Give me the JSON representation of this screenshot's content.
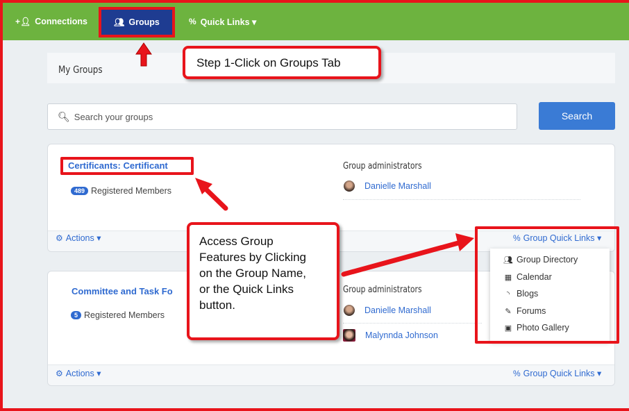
{
  "nav": {
    "connections_label": "Connections",
    "groups_label": "Groups",
    "quicklinks_label": "Quick Links ▾"
  },
  "header": {
    "title": "My Groups"
  },
  "search": {
    "placeholder": "Search your groups",
    "button_label": "Search"
  },
  "groups": [
    {
      "name": "Certificants: Certificant",
      "member_count": "489",
      "members_label": "Registered Members",
      "admins_title": "Group administrators",
      "admins": [
        "Danielle Marshall"
      ],
      "actions_label": "Actions ▾",
      "quicklinks_label": "Group Quick Links ▾"
    },
    {
      "name": "Committee and Task Fo",
      "member_count": "5",
      "members_label": "Registered Members",
      "admins_title": "Group administrators",
      "admins": [
        "Danielle Marshall",
        "Malynnda Johnson"
      ],
      "actions_label": "Actions ▾",
      "quicklinks_label": "Group Quick Links ▾"
    }
  ],
  "dropdown": {
    "items": [
      {
        "label": "Group Directory",
        "icon": "people-icon"
      },
      {
        "label": "Calendar",
        "icon": "calendar-icon"
      },
      {
        "label": "Blogs",
        "icon": "rss-icon"
      },
      {
        "label": "Forums",
        "icon": "edit-icon"
      },
      {
        "label": "Photo Gallery",
        "icon": "image-icon"
      }
    ]
  },
  "callouts": {
    "step1": "Step 1-Click on Groups Tab",
    "access_lines": [
      "Access Group",
      "Features by Clicking",
      "on the Group Name,",
      "or the Quick Links",
      "button."
    ]
  },
  "colors": {
    "nav_green": "#6db33f",
    "groups_tab": "#1e3c91",
    "link_blue": "#2f6ad0",
    "highlight_red": "#e8141b",
    "search_button": "#3a7bd5"
  }
}
